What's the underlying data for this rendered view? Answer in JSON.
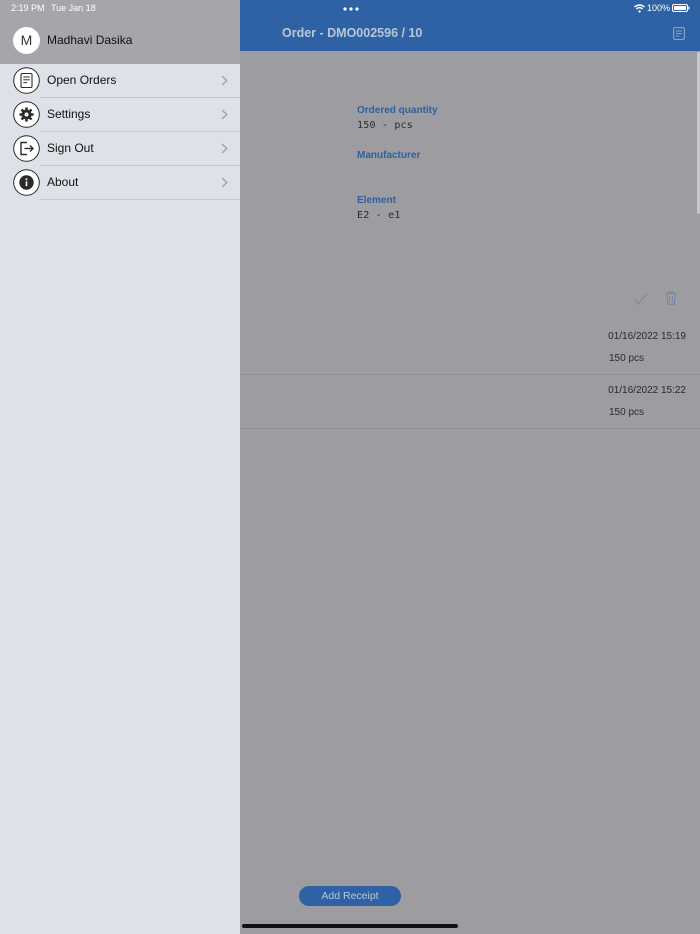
{
  "status_bar": {
    "time": "2:19 PM",
    "date": "Tue Jan 18",
    "battery": "100%"
  },
  "nav": {
    "title": "Order - DMO002596 / 10"
  },
  "fields": {
    "ordered_quantity_label": "Ordered quantity",
    "ordered_quantity_value": "150  -  pcs",
    "manufacturer_label": "Manufacturer",
    "element_label": "Element",
    "element_value": "E2  -  e1"
  },
  "receipts": [
    {
      "date": "01/16/2022 15:19",
      "qty": "150 pcs"
    },
    {
      "date": "01/16/2022 15:22",
      "qty": "150 pcs"
    }
  ],
  "add_receipt_label": "Add Receipt",
  "drawer": {
    "avatar_initial": "M",
    "user_name": "Madhavi Dasika",
    "items": [
      {
        "label": "Open Orders",
        "icon": "document-icon"
      },
      {
        "label": "Settings",
        "icon": "gear-icon"
      },
      {
        "label": "Sign Out",
        "icon": "sign-out-icon"
      },
      {
        "label": "About",
        "icon": "info-icon"
      }
    ]
  },
  "colors": {
    "nav_blue": "#2f62a4",
    "drawer_bg": "#dfe1e8",
    "label_blue": "#2f5f9e"
  }
}
